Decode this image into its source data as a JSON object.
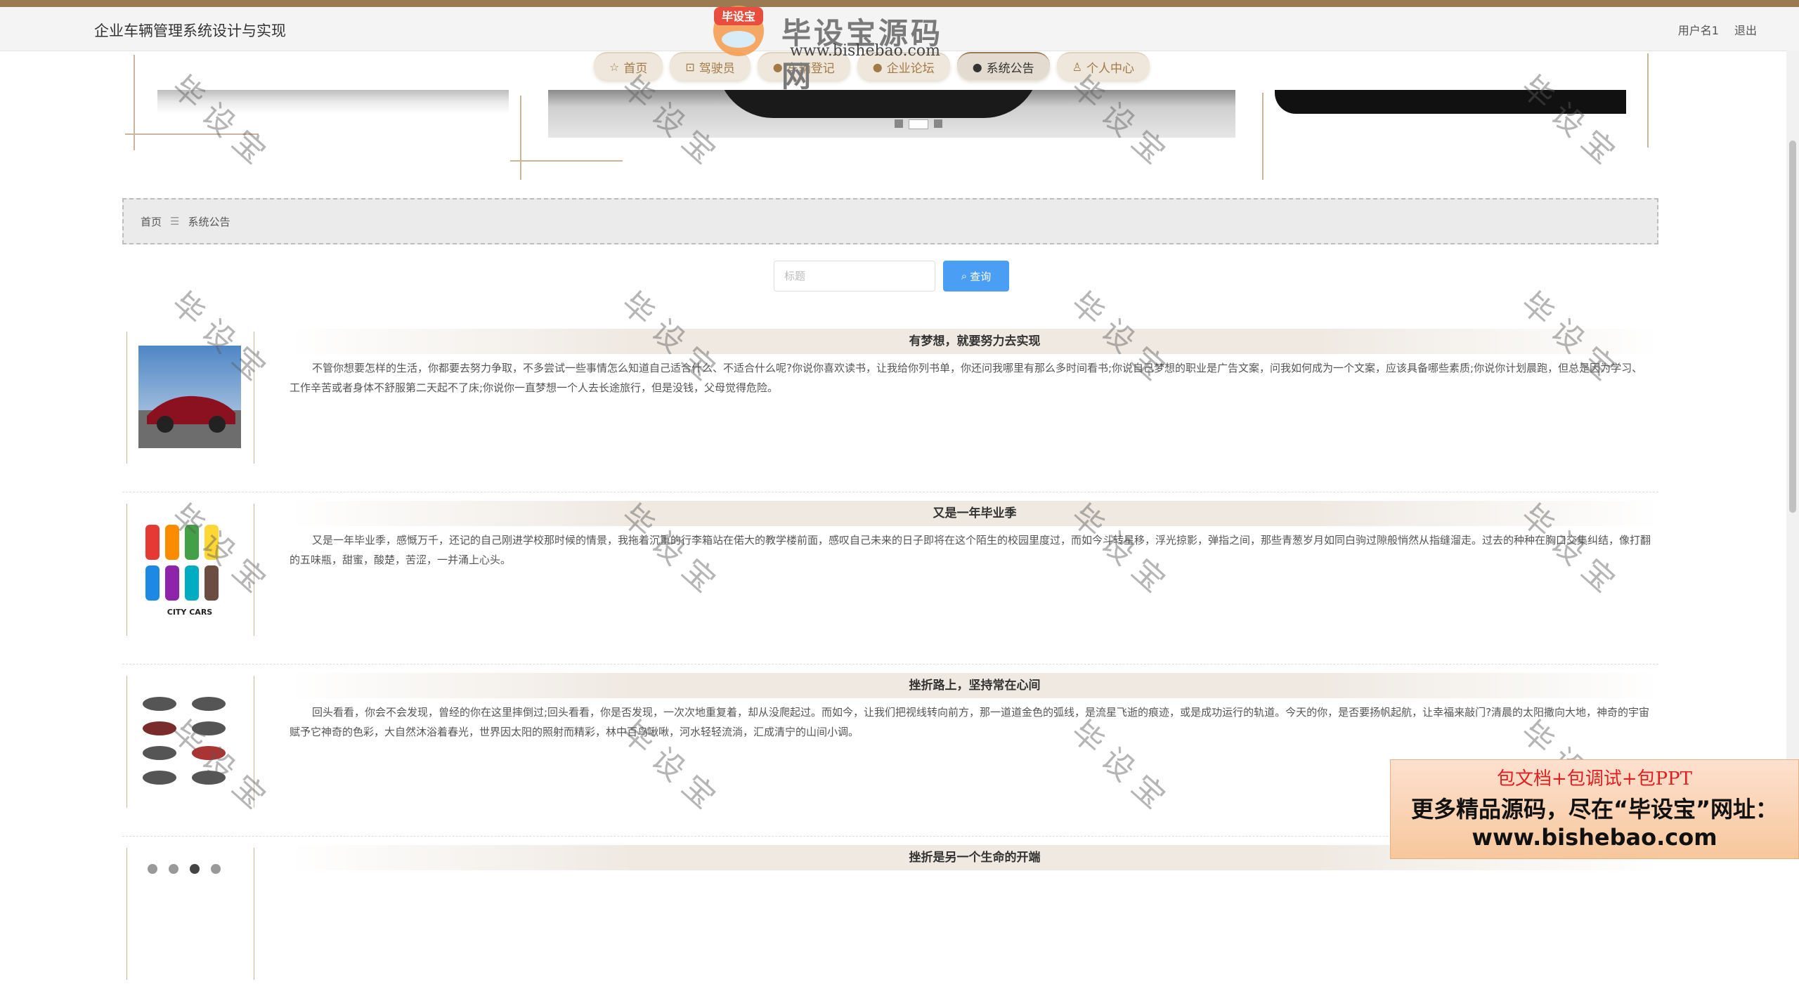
{
  "header": {
    "system_title": "企业车辆管理系统设计与实现",
    "username": "用户名1",
    "logout_label": "退出"
  },
  "nav": {
    "items": [
      {
        "label": "首页",
        "icon": "star-icon"
      },
      {
        "label": "驾驶员",
        "icon": "bag-icon"
      },
      {
        "label": "车辆登记",
        "icon": "info-icon"
      },
      {
        "label": "企业论坛",
        "icon": "question-icon"
      },
      {
        "label": "系统公告",
        "icon": "info-icon"
      },
      {
        "label": "个人中心",
        "icon": "user-icon"
      }
    ],
    "active_index": 4
  },
  "breadcrumb": {
    "home": "首页",
    "separator": "☰",
    "current": "系统公告"
  },
  "search": {
    "placeholder": "标题",
    "value": "",
    "button_label": "查询"
  },
  "news": [
    {
      "title": "有梦想，就要努力去实现",
      "body": "不管你想要怎样的生活，你都要去努力争取，不多尝试一些事情怎么知道自己适合什么、不适合什么呢?你说你喜欢读书，让我给你列书单，你还问我哪里有那么多时间看书;你说自己梦想的职业是广告文案，问我如何成为一个文案，应该具备哪些素质;你说你计划晨跑，但总是因为学习、工作辛苦或者身体不舒服第二天起不了床;你说你一直梦想一个人去长途旅行，但是没钱，父母觉得危险。",
      "thumb": "red-sports-car"
    },
    {
      "title": "又是一年毕业季",
      "body": "又是一年毕业季，感慨万千，还记的自己刚进学校那时候的情景，我拖着沉重的行李箱站在偌大的教学楼前面，感叹自己未来的日子即将在这个陌生的校园里度过，而如今斗转星移，浮光掠影，弹指之间，那些青葱岁月如同白驹过隙般悄然从指缝溜走。过去的种种在胸口交集纠结，像打翻的五味瓶，甜蜜，酸楚，苦涩，一并涌上心头。",
      "thumb": "city-cars",
      "thumb_caption": "CITY CARS"
    },
    {
      "title": "挫折路上，坚持常在心间",
      "body": "回头看看，你会不会发现，曾经的你在这里摔倒过;回头看看，你是否发现，一次次地重复着，却从没爬起过。而如今，让我们把视线转向前方，那一道道金色的弧线，是流星飞逝的痕迹，或是成功运行的轨道。今天的你，是否要扬帆起航，让幸福来敲门?清晨的太阳撒向大地，神奇的宇宙赋予它神奇的色彩，大自然沐浴着春光，世界因太阳的照射而精彩，林中百鸟啾啾，河水轻轻流淌，汇成清宁的山间小调。",
      "thumb": "car-diagrams"
    },
    {
      "title": "挫折是另一个生命的开端",
      "body": "",
      "thumb": "car-parts"
    }
  ],
  "watermark": {
    "text": "毕设宝"
  },
  "logo": {
    "badge": "毕设宝",
    "name": "毕设宝源码网",
    "url": "www.bishebao.com"
  },
  "promo": {
    "line1": "包文档+包调试+包PPT",
    "line2": "更多精品源码，尽在“毕设宝”网址：",
    "line3": "www.bishebao.com"
  },
  "colors": {
    "accent": "#9b7a52",
    "search_button": "#4a9ff5",
    "nav_bg": "#efe7dc"
  }
}
